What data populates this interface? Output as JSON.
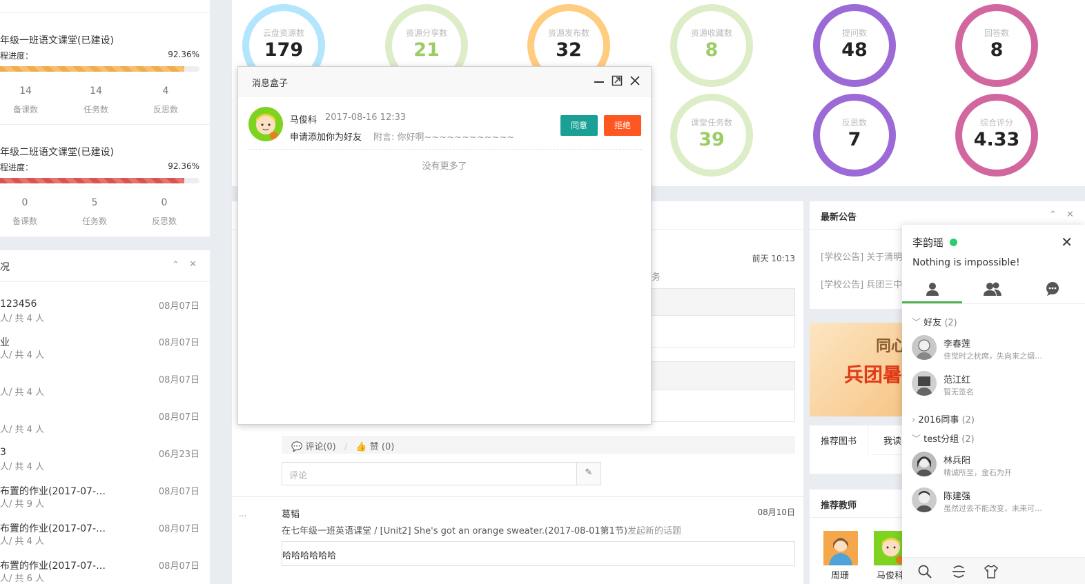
{
  "courses": [
    {
      "title": "年级一班语文课堂(已建设)",
      "progress_label": "程进度：",
      "progress": "92.36%",
      "bar_color": "orange",
      "stats": [
        {
          "value": "14",
          "label": "备课数"
        },
        {
          "value": "14",
          "label": "任务数"
        },
        {
          "value": "4",
          "label": "反思数"
        }
      ]
    },
    {
      "title": "年级二班语文课堂(已建设)",
      "progress_label": "程进度：",
      "progress": "92.36%",
      "bar_color": "red",
      "stats": [
        {
          "value": "0",
          "label": "备课数"
        },
        {
          "value": "5",
          "label": "任务数"
        },
        {
          "value": "0",
          "label": "反思数"
        }
      ]
    }
  ],
  "homework_panel": {
    "title": "况",
    "items": [
      {
        "title": "123456",
        "sub": "人/ 共 4 人",
        "date": "08月07日"
      },
      {
        "title": "业",
        "sub": "人/ 共 4 人",
        "date": "08月07日"
      },
      {
        "title": "",
        "sub": "人/ 共 4 人",
        "date": "08月07日"
      },
      {
        "title": "",
        "sub": "人/ 共 4 人",
        "date": "08月07日"
      },
      {
        "title": "3",
        "sub": "人/ 共 4 人",
        "date": "06月23日"
      },
      {
        "title": "布置的作业(2017-07-…",
        "sub": "人/ 共 9 人",
        "date": "08月07日"
      },
      {
        "title": "布置的作业(2017-07-…",
        "sub": "人/ 共 4 人",
        "date": "08月07日"
      },
      {
        "title": "布置的作业(2017-07-…",
        "sub": "人/ 共 6 人",
        "date": "08月07日"
      }
    ]
  },
  "stat_rings": [
    {
      "label": "云盘资源数",
      "value": "179",
      "color": "#b3e5fc",
      "value_color": "#222"
    },
    {
      "label": "资源分享数",
      "value": "21",
      "color": "#dcedc8",
      "value_color": "#9ccc65"
    },
    {
      "label": "资源发布数",
      "value": "32",
      "color": "#ffcc80",
      "value_color": "#222"
    },
    {
      "label": "资源收藏数",
      "value": "8",
      "color": "#dcedc8",
      "value_color": "#9ccc65"
    },
    {
      "label": "提问数",
      "value": "48",
      "color": "#9c6ad6",
      "value_color": "#222"
    },
    {
      "label": "回答数",
      "value": "8",
      "color": "#d2679f",
      "value_color": "#222"
    },
    {
      "label": "课堂任务数",
      "value": "39",
      "color": "#dcedc8",
      "value_color": "#9ccc65"
    },
    {
      "label": "反思数",
      "value": "7",
      "color": "#9c6ad6",
      "value_color": "#222"
    },
    {
      "label": "综合评分",
      "value": "4.33",
      "color": "#d2679f",
      "value_color": "#222"
    }
  ],
  "feed": {
    "time1": "前天 10:13",
    "fragment1": "务",
    "comment_label": "评论(0)",
    "like_label": "赞 (0)",
    "divider": "/",
    "comment_placeholder": "评论",
    "ellipsis": "...",
    "post": {
      "author": "葛韬",
      "date": "08月10日",
      "desc_prefix": "在七年级一班英语课堂 / [Unit2] She's got an orange sweater.(2017-08-01第1节)",
      "desc_suffix": "发起新的话题",
      "body": "哈哈哈哈哈哈"
    }
  },
  "notice": {
    "title": "最新公告",
    "items": [
      "[学校公告] 关于清明",
      "[学校公告] 兵团三中"
    ]
  },
  "banner": {
    "line1": "同心",
    "line2": "兵团暑"
  },
  "books": {
    "tab1": "推荐图书",
    "tab2": "我读"
  },
  "teachers": {
    "title": "推荐教师",
    "items": [
      {
        "name": "周珊"
      },
      {
        "name": "马俊科"
      }
    ]
  },
  "msgbox": {
    "title": "消息盒子",
    "request": {
      "name": "马俊科",
      "time": "2017-08-16 12:33",
      "text": "申请添加你为好友",
      "note": "附言: 你好啊~~~~~~~~~~~~"
    },
    "agree_label": "同意",
    "reject_label": "拒绝",
    "no_more": "没有更多了",
    "colors": {
      "agree": "#1aa094",
      "reject": "#ff5722"
    }
  },
  "chat": {
    "user": "李韵瑶",
    "signature": "Nothing is impossible!",
    "groups": [
      {
        "name": "好友",
        "count": "(2)",
        "open": true,
        "friends": [
          {
            "name": "李春莲",
            "sign": "佳觉时之枕席，失向来之烟…"
          },
          {
            "name": "范江红",
            "sign": "暂无签名"
          }
        ]
      },
      {
        "name": "2016同事",
        "count": "(2)",
        "open": false,
        "friends": []
      },
      {
        "name": "test分组",
        "count": "(2)",
        "open": true,
        "friends": [
          {
            "name": "林兵阳",
            "sign": "精诚所至，金石为开"
          },
          {
            "name": "陈建强",
            "sign": "虽然过去不能改变，未来可…"
          }
        ]
      }
    ]
  }
}
